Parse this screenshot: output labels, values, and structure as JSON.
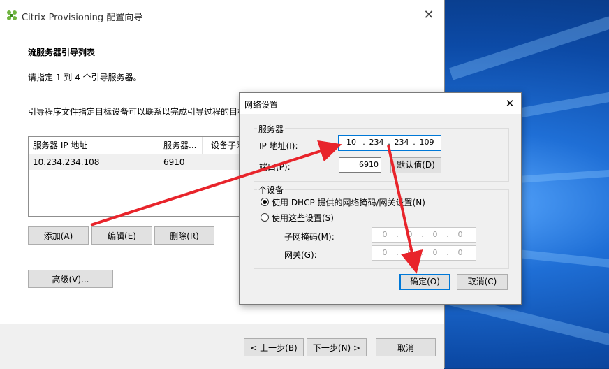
{
  "wizard": {
    "title": "Citrix Provisioning 配置向导",
    "heading": "流服务器引导列表",
    "instruction1": "请指定 1 到 4 个引导服务器。",
    "instruction2": "引导程序文件指定目标设备可以联系以完成引导过程的目标",
    "columns": [
      "服务器 IP 地址",
      "服务器...",
      "设备子网"
    ],
    "rows": [
      {
        "ip": "10.234.234.108",
        "port": "6910"
      }
    ],
    "buttons": {
      "add": "添加(A)",
      "edit": "编辑(E)",
      "delete": "删除(R)",
      "advanced": "高级(V)..."
    },
    "footer": {
      "back": "< 上一步(B)",
      "next": "下一步(N) >",
      "cancel": "取消"
    }
  },
  "network_dialog": {
    "title": "网络设置",
    "server_group": "服务器",
    "ip_label": "IP 地址(I):",
    "ip": [
      "10",
      "234",
      "234",
      "109"
    ],
    "port_label": "端口(P):",
    "port": "6910",
    "default_button": "默认值(D)",
    "device_group": "个设备",
    "radio_dhcp": "使用 DHCP 提供的网络掩码/网关设置(N)",
    "radio_custom": "使用这些设置(S)",
    "subnet_label": "子网掩码(M):",
    "subnet": [
      "0",
      "0",
      "0",
      "0"
    ],
    "gateway_label": "网关(G):",
    "gateway": [
      "0",
      "0",
      "0",
      "0"
    ],
    "ok": "确定(O)",
    "cancel": "取消(C)"
  },
  "colors": {
    "accent": "#0078d7",
    "arrow": "#e8242b"
  }
}
